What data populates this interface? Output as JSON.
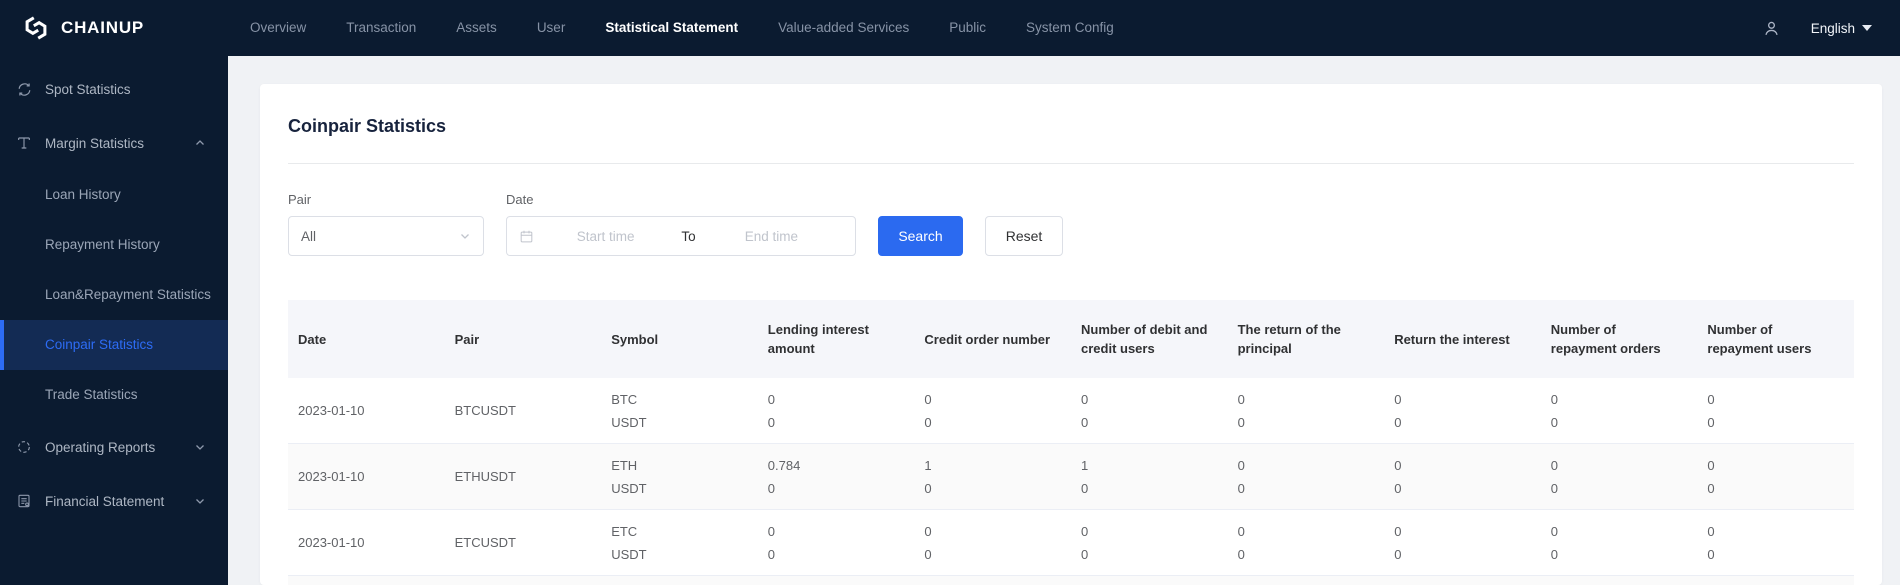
{
  "navbar": {
    "brand": "CHAINUP",
    "items": [
      {
        "label": "Overview",
        "active": false
      },
      {
        "label": "Transaction",
        "active": false
      },
      {
        "label": "Assets",
        "active": false
      },
      {
        "label": "User",
        "active": false
      },
      {
        "label": "Statistical Statement",
        "active": true
      },
      {
        "label": "Value-added Services",
        "active": false
      },
      {
        "label": "Public",
        "active": false
      },
      {
        "label": "System Config",
        "active": false
      }
    ],
    "language": "English"
  },
  "sidebar": {
    "sections": [
      {
        "label": "Spot Statistics",
        "icon": "spot-statistics-icon",
        "expandable": false,
        "expanded": false,
        "children": []
      },
      {
        "label": "Margin Statistics",
        "icon": "margin-statistics-icon",
        "expandable": true,
        "expanded": true,
        "children": [
          {
            "label": "Loan History",
            "active": false
          },
          {
            "label": "Repayment History",
            "active": false
          },
          {
            "label": "Loan&Repayment Statistics",
            "active": false
          },
          {
            "label": "Coinpair Statistics",
            "active": true
          },
          {
            "label": "Trade Statistics",
            "active": false
          }
        ]
      },
      {
        "label": "Operating Reports",
        "icon": "operating-reports-icon",
        "expandable": true,
        "expanded": false,
        "children": []
      },
      {
        "label": "Financial Statement",
        "icon": "financial-statement-icon",
        "expandable": true,
        "expanded": false,
        "children": []
      }
    ]
  },
  "page": {
    "title": "Coinpair Statistics",
    "filters": {
      "pair_label": "Pair",
      "pair_value": "All",
      "date_label": "Date",
      "start_placeholder": "Start time",
      "separator": "To",
      "end_placeholder": "End time",
      "search_label": "Search",
      "reset_label": "Reset"
    },
    "table": {
      "columns": [
        "Date",
        "Pair",
        "Symbol",
        "Lending interest\namount",
        "Credit order number",
        "Number of debit and\ncredit users",
        "The return of the\nprincipal",
        "Return the interest",
        "Number of\nrepayment orders",
        "Number of\nrepayment users"
      ],
      "rows": [
        {
          "date": "2023-01-10",
          "pair": "BTCUSDT",
          "sub": [
            {
              "symbol": "BTC",
              "values": [
                "0",
                "0",
                "0",
                "0",
                "0",
                "0",
                "0"
              ]
            },
            {
              "symbol": "USDT",
              "values": [
                "0",
                "0",
                "0",
                "0",
                "0",
                "0",
                "0"
              ]
            }
          ]
        },
        {
          "date": "2023-01-10",
          "pair": "ETHUSDT",
          "sub": [
            {
              "symbol": "ETH",
              "values": [
                "0.784",
                "1",
                "1",
                "0",
                "0",
                "0",
                "0"
              ]
            },
            {
              "symbol": "USDT",
              "values": [
                "0",
                "0",
                "0",
                "0",
                "0",
                "0",
                "0"
              ]
            }
          ]
        },
        {
          "date": "2023-01-10",
          "pair": "ETCUSDT",
          "sub": [
            {
              "symbol": "ETC",
              "values": [
                "0",
                "0",
                "0",
                "0",
                "0",
                "0",
                "0"
              ]
            },
            {
              "symbol": "USDT",
              "values": [
                "0",
                "0",
                "0",
                "0",
                "0",
                "0",
                "0"
              ]
            }
          ]
        }
      ]
    }
  },
  "colors": {
    "accent": "#2b6af0",
    "navbar_bg": "#0b1b30",
    "active_item_bg": "#132b54",
    "active_item_text": "#2d6cf5",
    "table_header_bg": "#f5f6fa"
  }
}
